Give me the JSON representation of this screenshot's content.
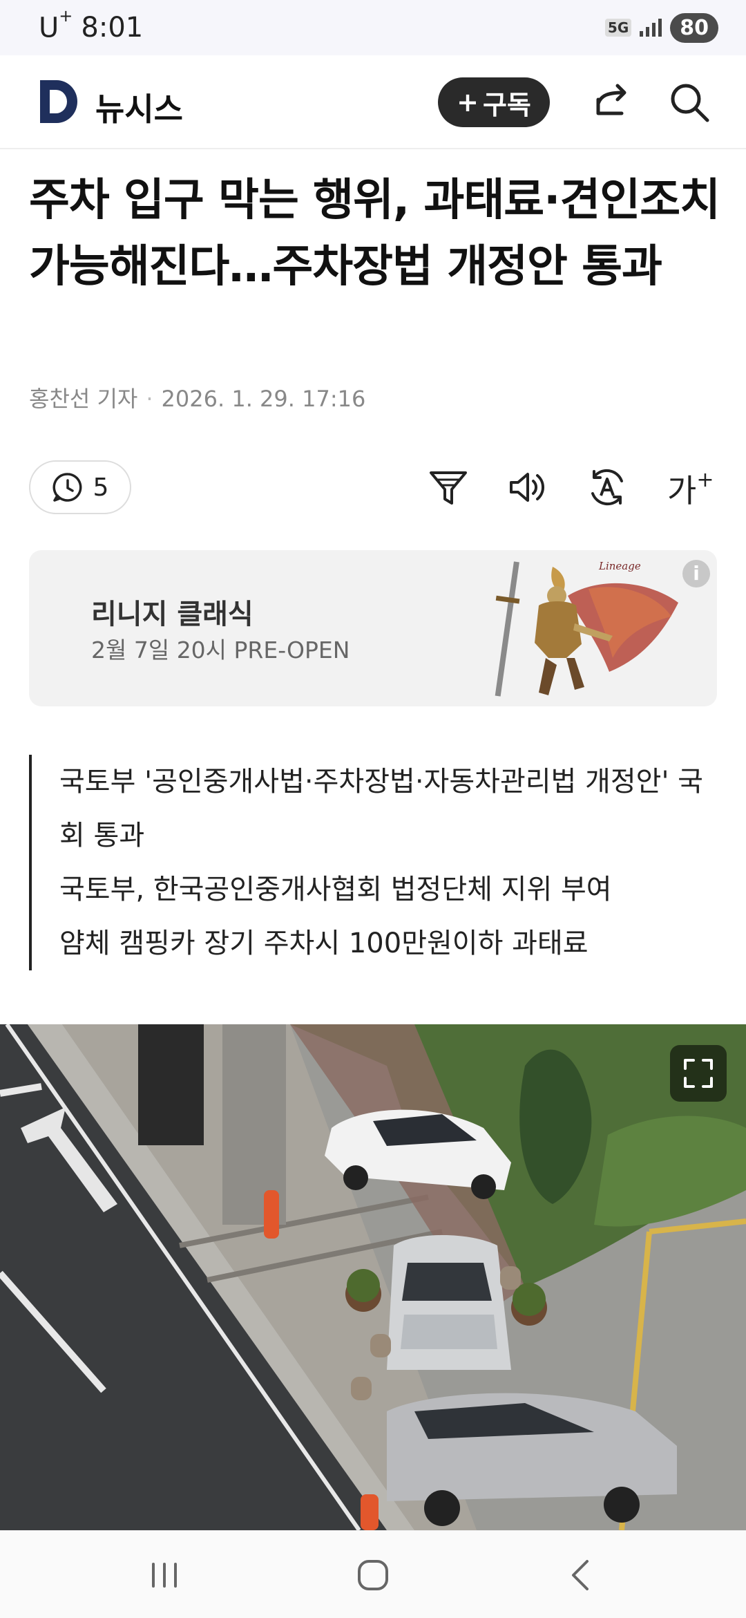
{
  "status": {
    "carrier": "U",
    "carrier_sup": "+",
    "time": "8:01",
    "network": "5G",
    "battery": "80"
  },
  "header": {
    "brand": "뉴시스",
    "subscribe_label": "구독",
    "subscribe_plus": "+"
  },
  "article": {
    "headline": "주차 입구 막는 행위, 과태료·견인조치 가능해진다…주차장법 개정안 통과",
    "reporter": "홍찬선 기자",
    "byline_separator": "·",
    "datetime": "2026. 1. 29. 17:16",
    "comment_count": "5",
    "font_size_label": "가",
    "font_size_plus": "+",
    "summary": [
      "국토부 '공인중개사법·주차장법·자동차관리법 개정안' 국회 통과",
      "국토부, 한국공인중개사협회 법정단체 지위 부여",
      "얌체 캠핑카 장기 주차시 100만원이하 과태료"
    ]
  },
  "ad": {
    "title": "리니지 클래식",
    "subtitle": "2월 7일 20시 PRE-OPEN",
    "info_symbol": "i"
  },
  "colors": {
    "brand_blue": "#1f2f5c",
    "subscribe_bg": "#2a2a2a",
    "text": "#111111",
    "meta": "#888888"
  }
}
